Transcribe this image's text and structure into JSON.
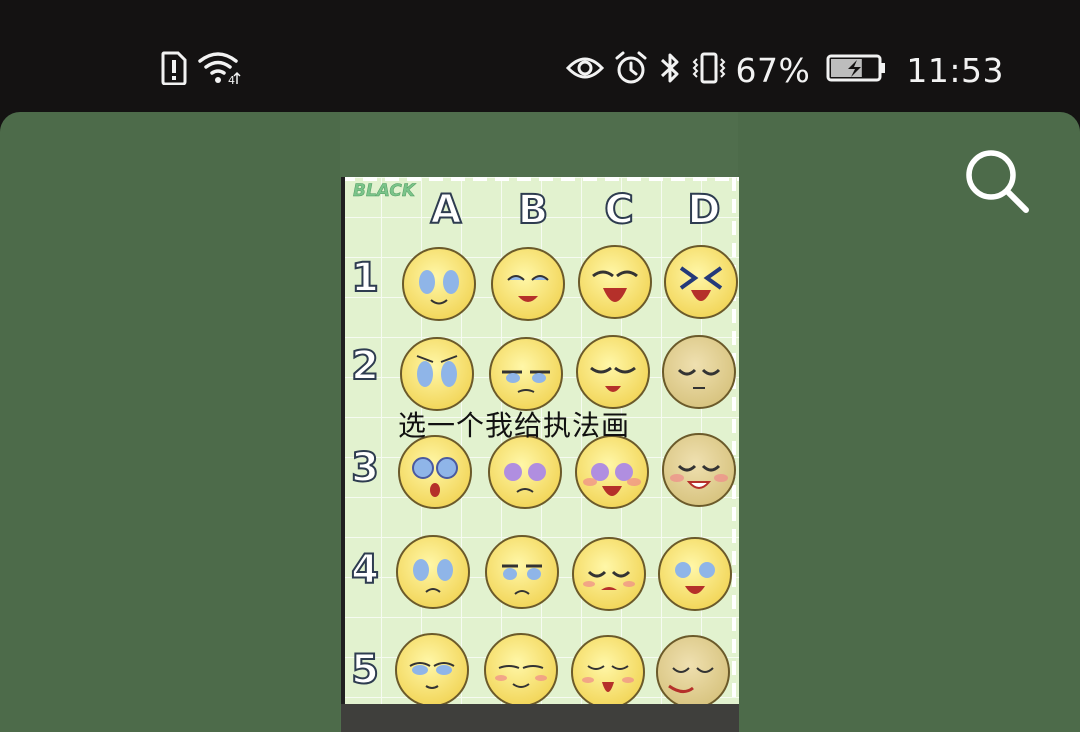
{
  "status_bar": {
    "left_icons": [
      "sim-alert-icon",
      "wifi-4g-icon"
    ],
    "right_icons": [
      "eye-icon",
      "alarm-icon",
      "bluetooth-icon",
      "vibrate-icon"
    ],
    "battery_percent": "67%",
    "battery_level": 0.67,
    "battery_charging": true,
    "time": "11:53"
  },
  "viewer": {
    "background_color": "#4d6b4a",
    "search_icon": "search-icon",
    "overlay_text": "选一个我给执法画"
  },
  "expression_chart": {
    "watermark": "BLACK",
    "columns": [
      "A",
      "B",
      "C",
      "D"
    ],
    "rows": [
      "1",
      "2",
      "3",
      "4",
      "5"
    ]
  }
}
